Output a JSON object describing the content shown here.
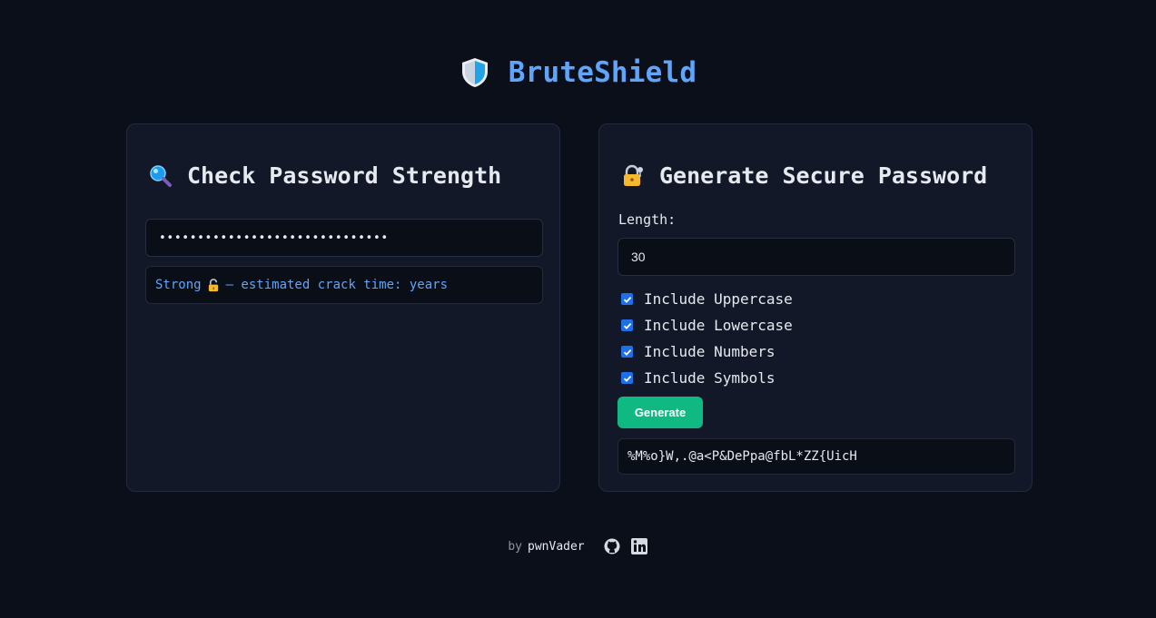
{
  "app": {
    "title": "BruteShield",
    "logo_icon": "shield-icon"
  },
  "colors": {
    "accent": "#60a5fa",
    "button": "#10b981",
    "background": "#0b0f19",
    "card": "#121827"
  },
  "checker": {
    "title": "Check Password Strength",
    "title_icon": "magnifier-icon",
    "password_value": "••••••••••••••••••••••••••••••",
    "result_strength": "Strong",
    "result_icon": "unlocked-lock-icon",
    "result_text": "— estimated crack time: years"
  },
  "generator": {
    "title": "Generate Secure Password",
    "title_icon": "lock-with-key-icon",
    "length_label": "Length:",
    "length_value": "30",
    "options": [
      {
        "label": "Include Uppercase",
        "checked": true
      },
      {
        "label": "Include Lowercase",
        "checked": true
      },
      {
        "label": "Include Numbers",
        "checked": true
      },
      {
        "label": "Include Symbols",
        "checked": true
      }
    ],
    "button_label": "Generate",
    "output": "%M%o}W,.@a<P&DePpa@fbL*ZZ{UicH"
  },
  "footer": {
    "by": "by",
    "author": "pwnVader",
    "icons": [
      "github-icon",
      "linkedin-icon"
    ]
  }
}
